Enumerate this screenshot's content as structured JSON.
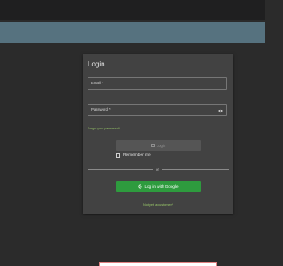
{
  "login_card": {
    "title": "Login",
    "email_label": "Email *",
    "email_value": "",
    "password_label": "Password *",
    "password_value": "",
    "forgot_password": "Forgot your password?",
    "login_button": "Login",
    "remember_me": "Remember me",
    "remember_checked": false,
    "divider_text": "or",
    "google_button": "Log in with Google",
    "signup_link": "Not yet a customer?"
  },
  "icons": {
    "eye": "eye-icon",
    "login": "login-icon",
    "google": "google-icon"
  },
  "colors": {
    "background": "#2b2b2b",
    "card": "#424242",
    "banner": "#56727f",
    "accent_link": "#9ac96a",
    "google_button": "#2e9b3e"
  }
}
